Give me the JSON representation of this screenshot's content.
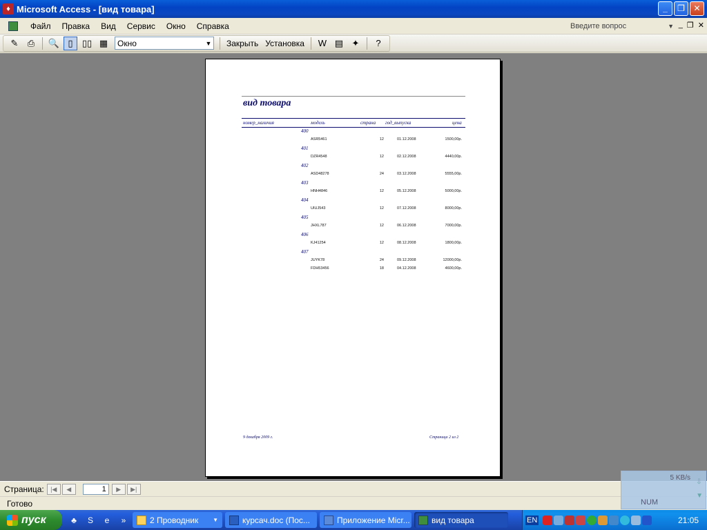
{
  "window": {
    "title": "Microsoft Access - [вид товара]",
    "controls": {
      "minimize": "_",
      "restore": "❐",
      "close": "✕"
    }
  },
  "menu": {
    "items": [
      "Файл",
      "Правка",
      "Вид",
      "Сервис",
      "Окно",
      "Справка"
    ],
    "question_placeholder": "Введите вопрос"
  },
  "toolbar": {
    "zoom_value": "Окно",
    "close_label": "Закрыть",
    "setup_label": "Установка"
  },
  "report": {
    "title": "вид товара",
    "headers": {
      "group": "номер_наличия",
      "model": "модель",
      "country": "страна",
      "year": "год_выпуска",
      "price": "цена"
    },
    "groups": [
      {
        "code": "400",
        "rows": [
          {
            "model": "ASR5461",
            "qty": "12",
            "date": "01.12.2008",
            "price": "1500,00р."
          }
        ]
      },
      {
        "code": "401",
        "rows": [
          {
            "model": "DZR4548",
            "qty": "12",
            "date": "02.12.2008",
            "price": "4440,00р."
          }
        ]
      },
      {
        "code": "402",
        "rows": [
          {
            "model": "ASD48278",
            "qty": "24",
            "date": "03.12.2008",
            "price": "5555,00р."
          }
        ]
      },
      {
        "code": "403",
        "rows": [
          {
            "model": "HNH4846",
            "qty": "12",
            "date": "05.12.2008",
            "price": "5000,00р."
          }
        ]
      },
      {
        "code": "404",
        "rows": [
          {
            "model": "UIUJ543",
            "qty": "12",
            "date": "07.12.2008",
            "price": "8000,00р."
          }
        ]
      },
      {
        "code": "405",
        "rows": [
          {
            "model": "JHXL787",
            "qty": "12",
            "date": "06.12.2008",
            "price": "7000,00р."
          }
        ]
      },
      {
        "code": "406",
        "rows": [
          {
            "model": "KJ41254",
            "qty": "12",
            "date": "08.12.2008",
            "price": "1800,00р."
          }
        ]
      },
      {
        "code": "407",
        "rows": [
          {
            "model": "JUYK78",
            "qty": "24",
            "date": "09.12.2008",
            "price": "12000,00р."
          },
          {
            "model": "FDH53456",
            "qty": "18",
            "date": "04.12.2008",
            "price": "4600,00р."
          }
        ]
      }
    ],
    "footer_date": "9 декабря 2009 г.",
    "footer_page": "Страница 2 из 2"
  },
  "navigation": {
    "label": "Страница:",
    "page": "1"
  },
  "status": {
    "text": "Готово"
  },
  "netwidget": {
    "speed": "5 KB/s",
    "num": "NUM"
  },
  "taskbar": {
    "start": "пуск",
    "tasks": [
      {
        "label": "2 Проводник"
      },
      {
        "label": "курсач.doc (Пос..."
      },
      {
        "label": "Приложение Micr..."
      },
      {
        "label": "вид товара"
      }
    ],
    "lang": "EN",
    "clock": "21:05"
  }
}
